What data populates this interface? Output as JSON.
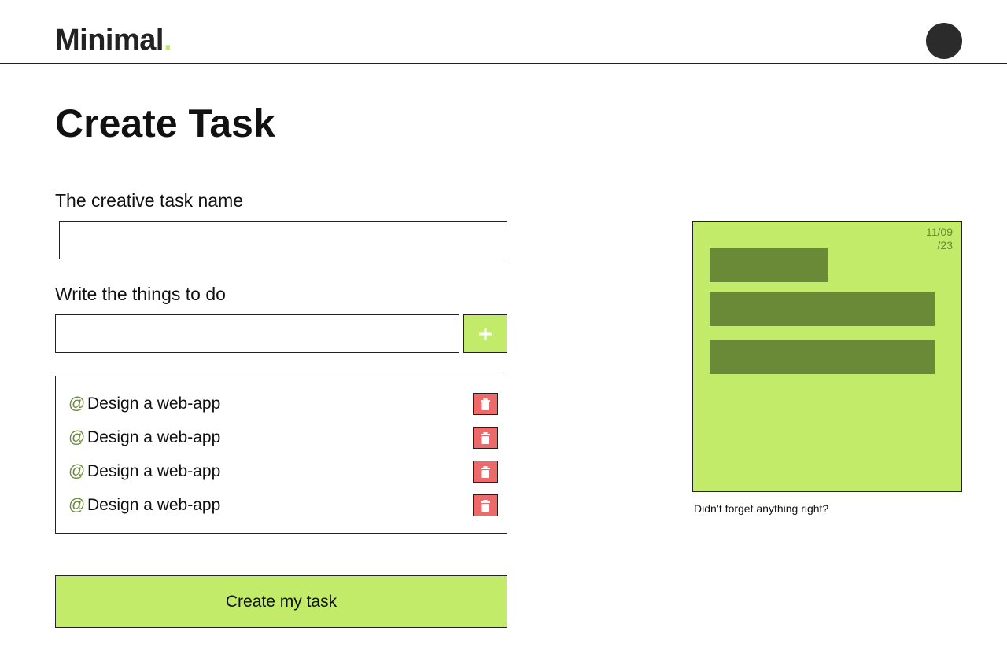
{
  "header": {
    "logo_text": "Minimal",
    "logo_dot": ".",
    "accent_color": "#c2eb6a"
  },
  "main": {
    "title": "Create Task",
    "task_name_label": "The creative task name",
    "task_name_value": "",
    "todo_label": "Write the things to do",
    "todo_input_value": "",
    "add_button_icon": "plus-icon",
    "todos": [
      {
        "prefix": "@",
        "text": "Design a web-app"
      },
      {
        "prefix": "@",
        "text": "Design a web-app"
      },
      {
        "prefix": "@",
        "text": "Design a web-app"
      },
      {
        "prefix": "@",
        "text": "Design a web-app"
      }
    ],
    "delete_icon": "trash-icon",
    "delete_color": "#ed6a6a",
    "create_button_label": "Create my task"
  },
  "preview": {
    "date_line1": "11/09",
    "date_line2": "/23",
    "card_color": "#c2eb6a",
    "bar_color": "#6b8a38",
    "caption": "Didn’t forget anything right?"
  }
}
